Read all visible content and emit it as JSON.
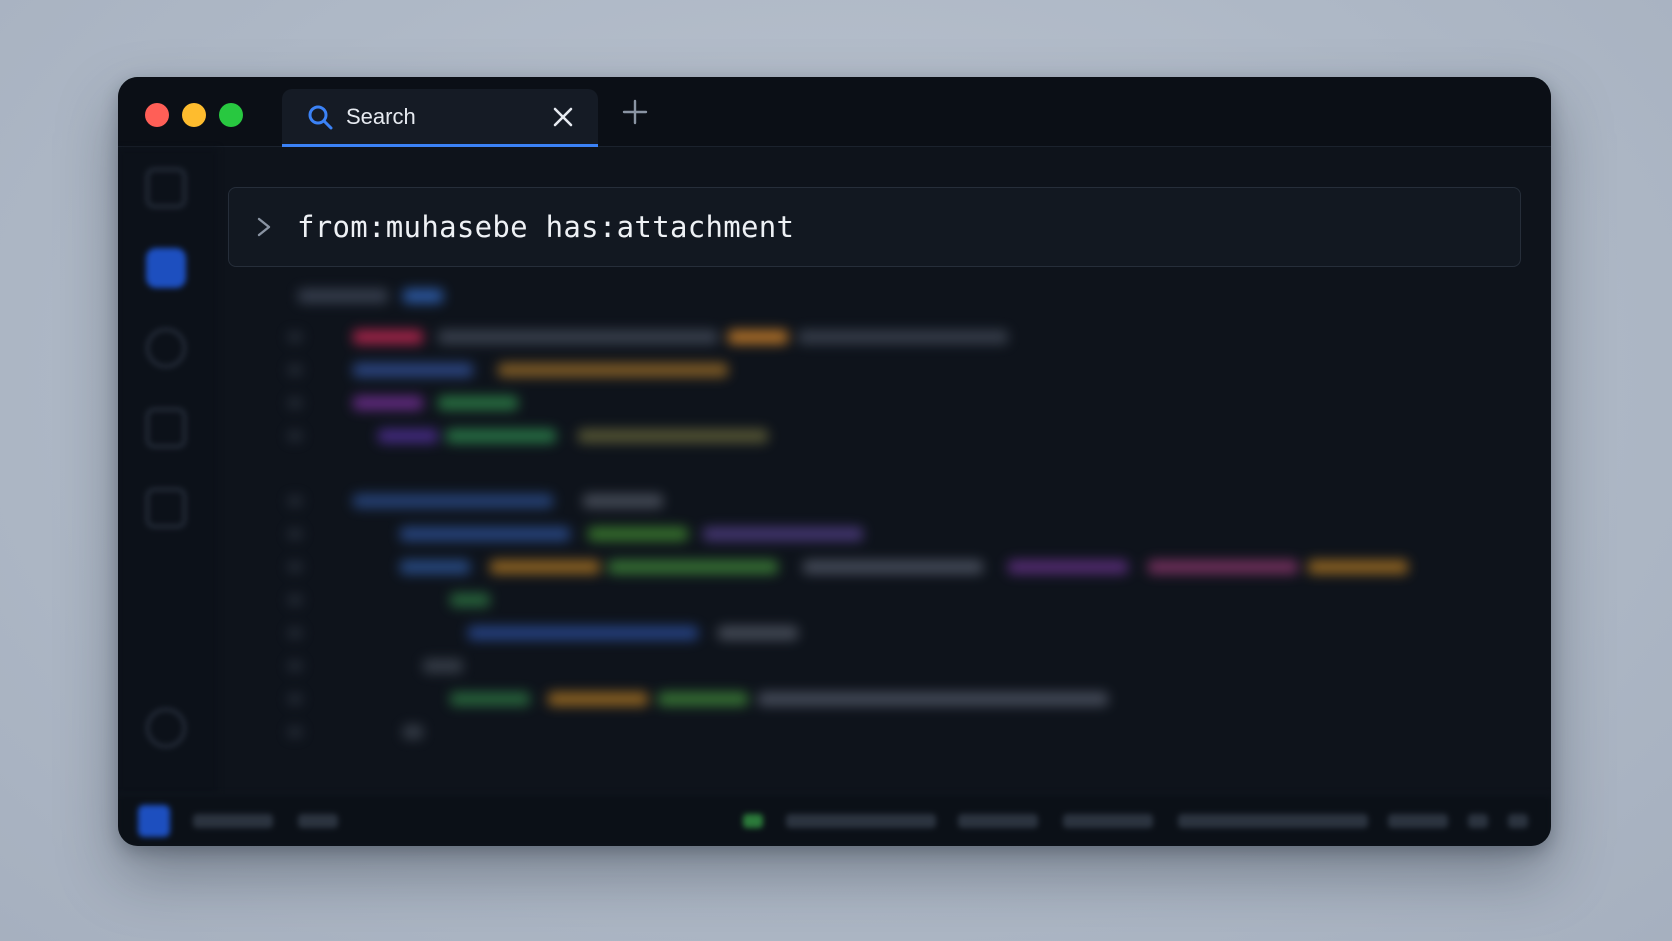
{
  "tab": {
    "title": "Search",
    "icon": "search-icon"
  },
  "command": {
    "prompt_icon": "chevron-right-icon",
    "query": "from:muhasebe has:attachment"
  },
  "colors": {
    "accent": "#3b82f6",
    "close": "#ff5f57",
    "minimize": "#febc2e",
    "maximize": "#28c840"
  }
}
